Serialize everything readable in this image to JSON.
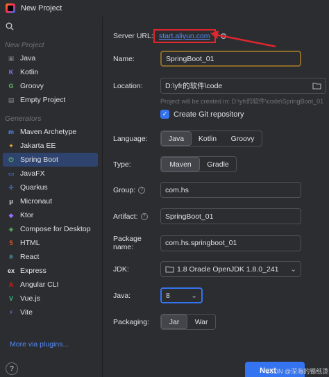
{
  "window": {
    "title": "New Project"
  },
  "sidebar": {
    "sections": [
      {
        "header": "New Project",
        "items": [
          {
            "label": "Java",
            "icon": "java-folder-icon",
            "color": "#6f737a"
          },
          {
            "label": "Kotlin",
            "icon": "kotlin-icon",
            "color": "#9a6cff"
          },
          {
            "label": "Groovy",
            "icon": "groovy-icon",
            "color": "#5fb865"
          },
          {
            "label": "Empty Project",
            "icon": "empty-project-icon",
            "color": "#8c8f94"
          }
        ]
      },
      {
        "header": "Generators",
        "items": [
          {
            "label": "Maven Archetype",
            "icon": "maven-icon",
            "color": "#548af7"
          },
          {
            "label": "Jakarta EE",
            "icon": "jakarta-icon",
            "color": "#f0a732"
          },
          {
            "label": "Spring Boot",
            "icon": "spring-icon",
            "color": "#5fb865",
            "selected": true
          },
          {
            "label": "JavaFX",
            "icon": "javafx-icon",
            "color": "#548af7"
          },
          {
            "label": "Quarkus",
            "icon": "quarkus-icon",
            "color": "#548af7"
          },
          {
            "label": "Micronaut",
            "icon": "micronaut-icon",
            "color": "#dfe1e5"
          },
          {
            "label": "Ktor",
            "icon": "ktor-icon",
            "color": "#9a6cff"
          },
          {
            "label": "Compose for Desktop",
            "icon": "compose-icon",
            "color": "#5fb865"
          },
          {
            "label": "HTML",
            "icon": "html-icon",
            "color": "#e5562a"
          },
          {
            "label": "React",
            "icon": "react-icon",
            "color": "#61dafb"
          },
          {
            "label": "Express",
            "icon": "express-icon",
            "color": "#dfe1e5"
          },
          {
            "label": "Angular CLI",
            "icon": "angular-icon",
            "color": "#dd1b16"
          },
          {
            "label": "Vue.js",
            "icon": "vue-icon",
            "color": "#41b883"
          },
          {
            "label": "Vite",
            "icon": "vite-icon",
            "color": "#a970ff"
          }
        ]
      }
    ],
    "plugins_link": "More via plugins...",
    "help": "?"
  },
  "form": {
    "server_url": {
      "label": "Server URL:",
      "value": "start.aliyun.com"
    },
    "name": {
      "label": "Name:",
      "value": "SpringBoot_01"
    },
    "location": {
      "label": "Location:",
      "value": "D:\\yfr的软件\\code",
      "hint": "Project will be created in: D:\\yfr的软件\\code\\SpringBoot_01"
    },
    "git": {
      "label": "Create Git repository",
      "checked": true
    },
    "language": {
      "label": "Language:",
      "options": [
        "Java",
        "Kotlin",
        "Groovy"
      ],
      "selected": "Java"
    },
    "type": {
      "label": "Type:",
      "options": [
        "Maven",
        "Gradle"
      ],
      "selected": "Maven"
    },
    "group": {
      "label": "Group:",
      "value": "com.hs"
    },
    "artifact": {
      "label": "Artifact:",
      "value": "SpringBoot_01"
    },
    "package": {
      "label": "Package name:",
      "value": "com.hs.springboot_01"
    },
    "jdk": {
      "label": "JDK:",
      "value": "1.8 Oracle OpenJDK 1.8.0_241"
    },
    "java": {
      "label": "Java:",
      "value": "8"
    },
    "packaging": {
      "label": "Packaging:",
      "options": [
        "Jar",
        "War"
      ],
      "selected": "Jar"
    }
  },
  "footer": {
    "next_label": "Next",
    "watermark": "CSDN @深海的锡纸烫"
  },
  "colors": {
    "accent": "#3574f0",
    "annotation_red": "#e0262e",
    "link": "#548af7"
  }
}
